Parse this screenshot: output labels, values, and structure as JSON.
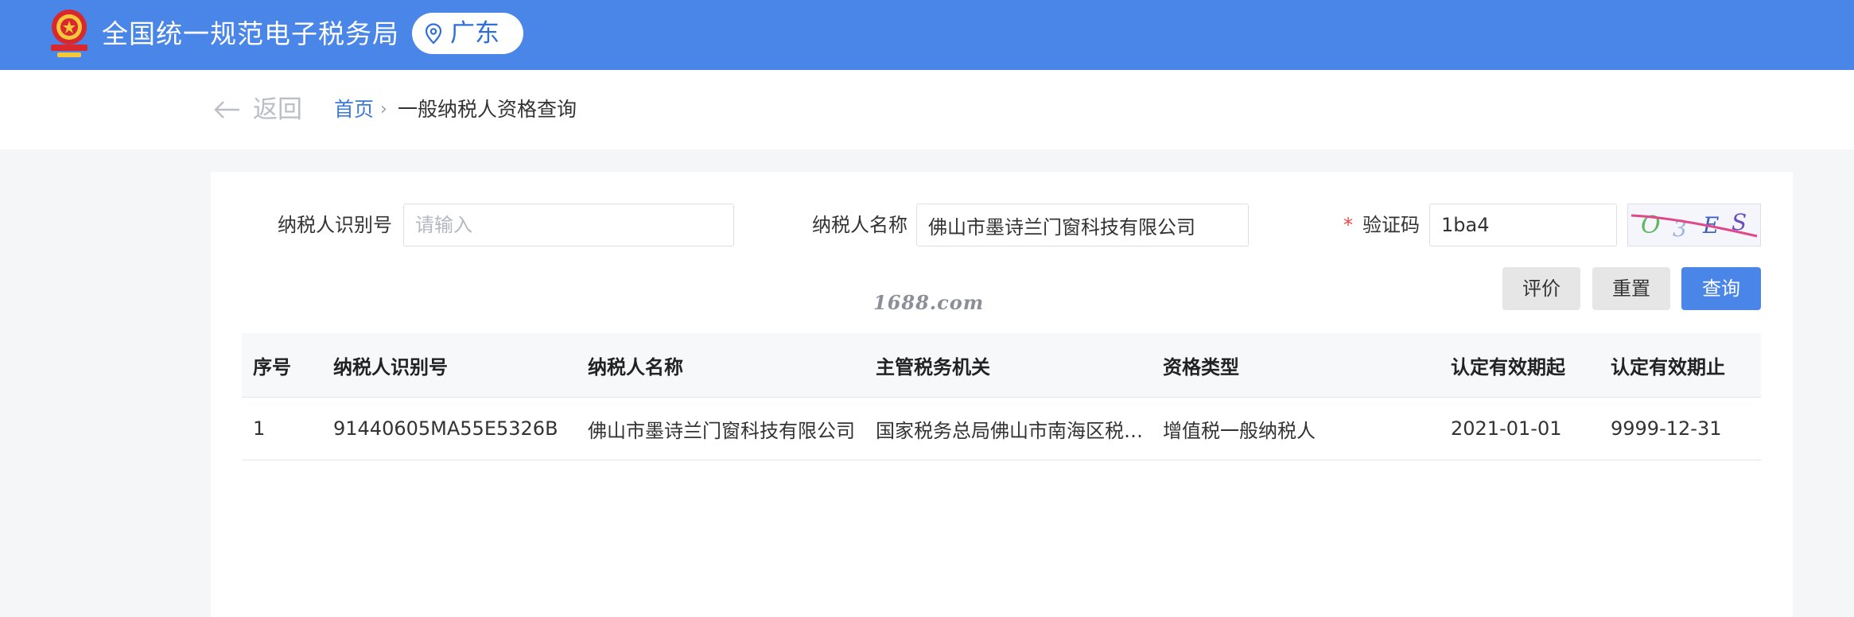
{
  "header": {
    "title": "全国统一规范电子税务局",
    "region": "广东",
    "emblem_icon": "national-emblem-icon",
    "pin_icon": "location-pin-icon",
    "brand_color": "#4a86e8"
  },
  "nav": {
    "back_label": "返回",
    "breadcrumb_home": "首页",
    "breadcrumb_sep": "›",
    "breadcrumb_current": "一般纳税人资格查询"
  },
  "form": {
    "taxpayer_id_label": "纳税人识别号",
    "taxpayer_id_value": "",
    "taxpayer_id_placeholder": "请输入",
    "taxpayer_name_label": "纳税人名称",
    "taxpayer_name_value": "佛山市墨诗兰门窗科技有限公司",
    "captcha_required_mark": "*",
    "captcha_label": "验证码",
    "captcha_value": "1ba4",
    "captcha_image_text": "0 3 E S"
  },
  "buttons": {
    "evaluate": "评价",
    "reset": "重置",
    "query": "查询"
  },
  "watermark": "1688.com",
  "table": {
    "columns": [
      "序号",
      "纳税人识别号",
      "纳税人名称",
      "主管税务机关",
      "资格类型",
      "认定有效期起",
      "认定有效期止"
    ],
    "rows": [
      [
        "1",
        "91440605MA55E5326B",
        "佛山市墨诗兰门窗科技有限公司",
        "国家税务总局佛山市南海区税…",
        "增值税一般纳税人",
        "2021-01-01",
        "9999-12-31"
      ]
    ]
  }
}
